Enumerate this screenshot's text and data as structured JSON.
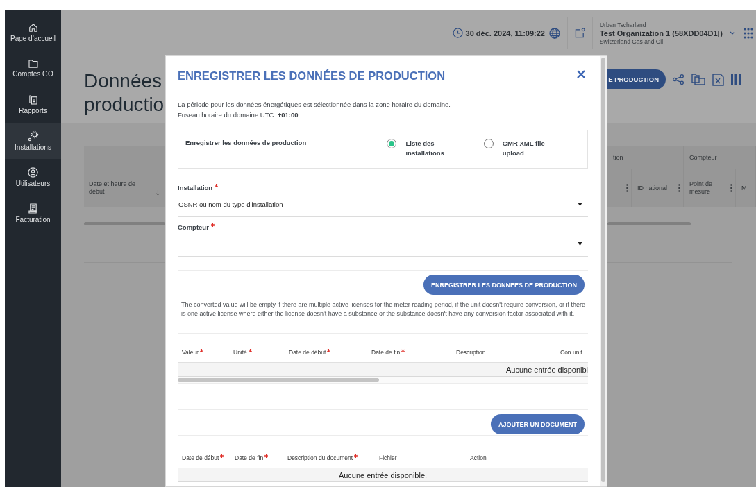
{
  "sidebar": {
    "items": [
      {
        "label": "Page d’accueil",
        "selected": false
      },
      {
        "label": "Comptes GO",
        "selected": false
      },
      {
        "label": "Rapports",
        "selected": false
      },
      {
        "label": "Installations",
        "selected": true
      },
      {
        "label": "Utilisateurs",
        "selected": false
      },
      {
        "label": "Facturation",
        "selected": false
      }
    ]
  },
  "header": {
    "datetime": "30 déc. 2024, 11:09:22",
    "user": "Urban Tscharland",
    "organization": "Test Organization 1 (58XDD04D1[)",
    "company": "Switzerland Gas and Oil"
  },
  "page": {
    "title_lines": [
      "Données",
      "productio"
    ],
    "action_button": "E PRODUCTION"
  },
  "background_table": {
    "first_column": "Date et heure de début",
    "group_headers": [
      "tion",
      "Compteur"
    ],
    "columns": [
      "ID national",
      "Point de mesure",
      "M"
    ]
  },
  "modal": {
    "title": "ENREGISTRER LES DONNÉES DE PRODUCTION",
    "intro": [
      "La période pour les données énergétiques est sélectionnée dans la zone horaire du domaine.",
      "Fuseau horaire du domaine UTC: **+01:00**"
    ],
    "source": {
      "label": "Enregistrer les données de production",
      "options": [
        {
          "label": "Liste des installations",
          "selected": true
        },
        {
          "label": "GMR XML file upload",
          "selected": false
        }
      ]
    },
    "fields": [
      {
        "label": "Installation",
        "required": true,
        "value": "GSNR ou nom du type d’installation"
      },
      {
        "label": "Compteur",
        "required": true
      }
    ],
    "save_button": "ENREGISTRER LES DONNÉES DE PRODUCTION",
    "note": "The converted value will be empty if there are multiple active licenses for the meter reading period, if the unit doesn't require conversion, or if there is one active license where either the license doesn't have a substance or the substance doesn't have any conversion factor associated with it.",
    "values_table": {
      "columns": [
        {
          "label": "Valeur",
          "required": true
        },
        {
          "label": "Unité",
          "required": true
        },
        {
          "label": "Date de début",
          "required": true
        },
        {
          "label": "Date de fin",
          "required": true
        },
        {
          "label": "Description",
          "required": false
        },
        {
          "label": "Con unit",
          "required": false
        }
      ],
      "empty_text": "Aucune entrée disponibl"
    },
    "add_document_button": "AJOUTER UN DOCUMENT",
    "documents_table": {
      "columns": [
        {
          "label": "Date de début",
          "required": true
        },
        {
          "label": "Date de fin",
          "required": true
        },
        {
          "label": "Description du document",
          "required": true
        },
        {
          "label": "Fichier",
          "required": false
        },
        {
          "label": "Action",
          "required": false
        }
      ],
      "empty_text": "Aucune entrée disponible."
    }
  }
}
